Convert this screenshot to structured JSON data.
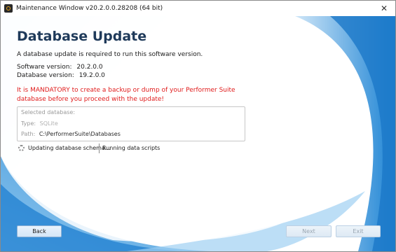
{
  "window": {
    "title": "Maintenance Window v20.2.0.0.28208 (64 bit)",
    "close_glyph": "✕"
  },
  "page": {
    "heading": "Database Update",
    "intro": "A database update is required to run this software version.",
    "software_version_label": "Software version:",
    "software_version": "20.2.0.0",
    "database_version_label": "Database version:",
    "database_version": "19.2.0.0",
    "warning": "It is MANDATORY to create a backup or dump of your Performer Suite database before you proceed with the update!"
  },
  "database_box": {
    "heading": "Selected database:",
    "type_label": "Type:",
    "type_value": "SQLite",
    "path_label": "Path:",
    "path_value": "C:\\PerformerSuite\\Databases"
  },
  "status": {
    "step": "Updating database schema...",
    "detail": "Running data scripts"
  },
  "buttons": {
    "back": "Back",
    "next": "Next",
    "exit": "Exit"
  },
  "colors": {
    "heading": "#1f3a5a",
    "warning": "#e01b1b",
    "swoosh_blue": "#1f7fd0"
  }
}
